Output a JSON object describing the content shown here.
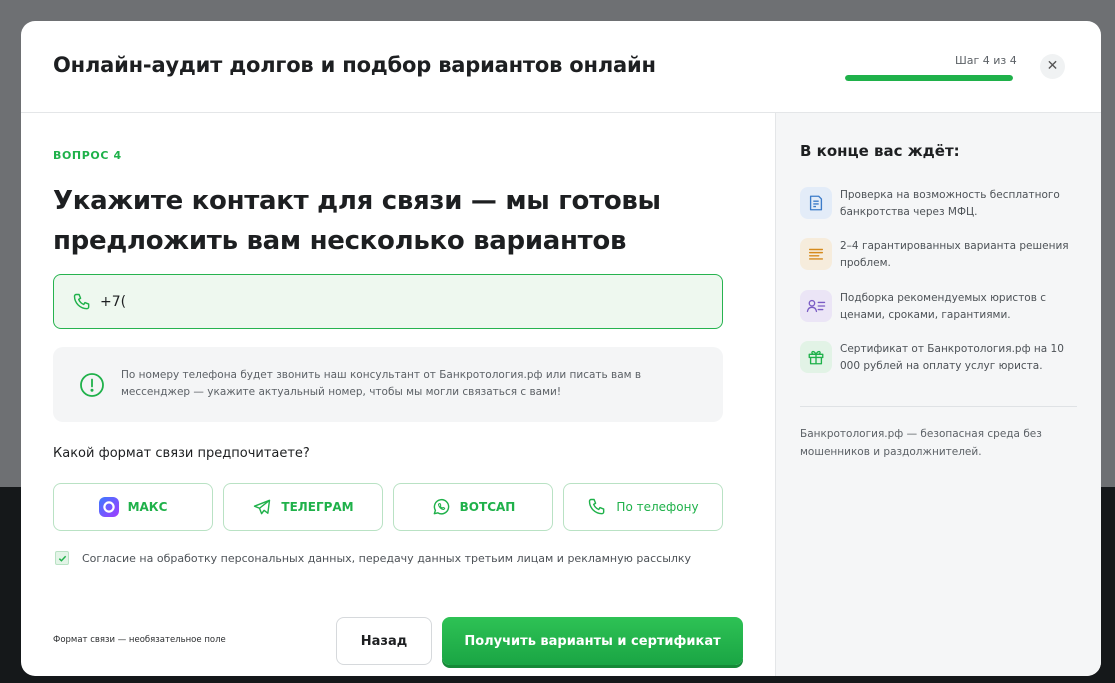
{
  "modal": {
    "title": "Онлайн-аудит долгов и подбор вариантов онлайн",
    "step_label": "Шаг 4 из 4",
    "progress_fraction": 1.0,
    "close_symbol": "✕"
  },
  "question": {
    "number_label": "ВОПРОС 4",
    "title": "Укажите контакт для связи — мы готовы предложить вам несколько вариантов"
  },
  "phone_input": {
    "value": "+7(",
    "icon": "phone-icon"
  },
  "info": {
    "icon": "exclamation-circle-icon",
    "text": "По номеру телефона будет звонить наш консультант от Банкротология.рф или писать вам в мессенджер — укажите актуальный номер, чтобы мы могли связаться с вами!"
  },
  "format": {
    "question": "Какой формат связи предпочитаете?",
    "options": [
      {
        "label": "МАКС",
        "icon": "max-messenger-icon"
      },
      {
        "label": "ТЕЛЕГРАМ",
        "icon": "telegram-icon"
      },
      {
        "label": "ВОТСАП",
        "icon": "whatsapp-icon"
      },
      {
        "label": "По телефону",
        "icon": "phone-icon"
      }
    ]
  },
  "consent": {
    "checked": true,
    "text": "Согласие на обработку персональных данных, передачу данных третьим лицам и рекламную рассылку"
  },
  "footer": {
    "optional_note": "Формат связи — необязательное поле",
    "back_label": "Назад",
    "submit_label": "Получить варианты и сертификат"
  },
  "sidebar": {
    "title": "В конце вас ждёт:",
    "items": [
      {
        "text": "Проверка на возможность бесплатного банкротства через МФЦ.",
        "icon": "document-icon",
        "color": "#3d7cc9"
      },
      {
        "text": "2–4 гарантированных варианта решения проблем.",
        "icon": "list-lines-icon",
        "color": "#d68a1c"
      },
      {
        "text": "Подборка рекомендуемых юристов с ценами, сроками, гарантиями.",
        "icon": "person-list-icon",
        "color": "#7a5bc4"
      },
      {
        "text": "Сертификат от Банкротология.рф на 10 000 рублей на оплату услуг юриста.",
        "icon": "gift-icon",
        "color": "#1fb14a"
      }
    ],
    "footer_text": "Банкротология.рф — безопасная среда без мошенников и раздолжнителей."
  },
  "colors": {
    "accent": "#1fb14a",
    "accent_light": "#eef8ef",
    "sidebar_bg": "#f5f6f7"
  }
}
